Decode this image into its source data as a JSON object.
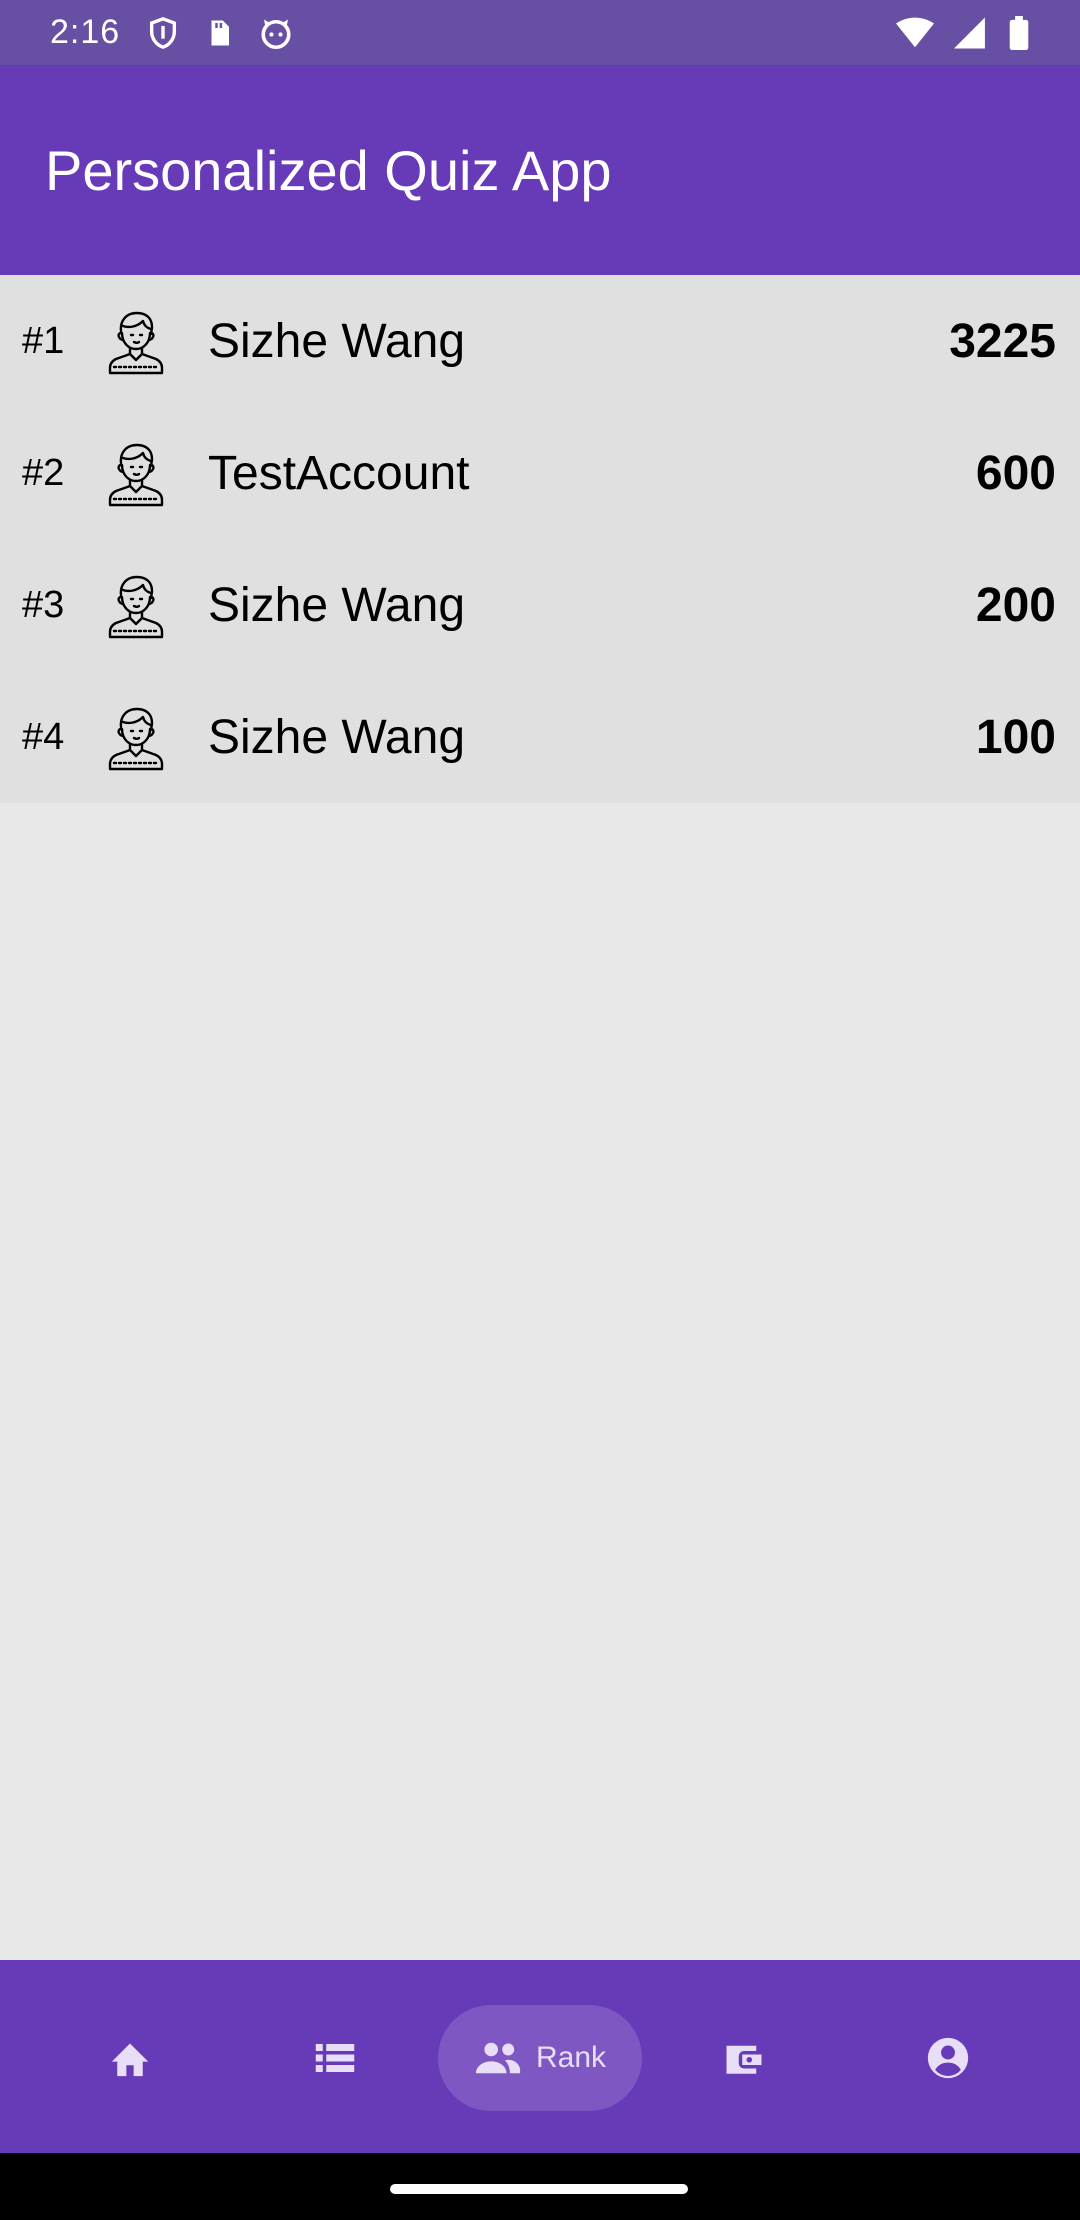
{
  "status_bar": {
    "time": "2:16",
    "left_icons": [
      "shield-icon",
      "sd-card-icon",
      "cat-face-icon"
    ],
    "right_icons": [
      "wifi-icon",
      "signal-icon",
      "battery-icon"
    ]
  },
  "app_bar": {
    "title": "Personalized Quiz App"
  },
  "leaderboard": {
    "rows": [
      {
        "rank": "#1",
        "name": "Sizhe Wang",
        "score": "3225"
      },
      {
        "rank": "#2",
        "name": "TestAccount",
        "score": "600"
      },
      {
        "rank": "#3",
        "name": "Sizhe Wang",
        "score": "200"
      },
      {
        "rank": "#4",
        "name": "Sizhe Wang",
        "score": "100"
      }
    ]
  },
  "bottom_nav": {
    "selected": "rank",
    "items": [
      {
        "id": "home",
        "icon": "home-icon",
        "label": ""
      },
      {
        "id": "list",
        "icon": "list-icon",
        "label": ""
      },
      {
        "id": "rank",
        "icon": "group-icon",
        "label": "Rank"
      },
      {
        "id": "wallet",
        "icon": "wallet-icon",
        "label": ""
      },
      {
        "id": "profile",
        "icon": "account-circle-icon",
        "label": ""
      }
    ]
  },
  "colors": {
    "status_bar": "#6750a4",
    "app_bar": "#673ab7",
    "list_background": "#e0e0e0",
    "page_background": "#e8e8e8",
    "nav_selected_pill": "#7e57c2",
    "nav_icon": "#e8def8"
  }
}
